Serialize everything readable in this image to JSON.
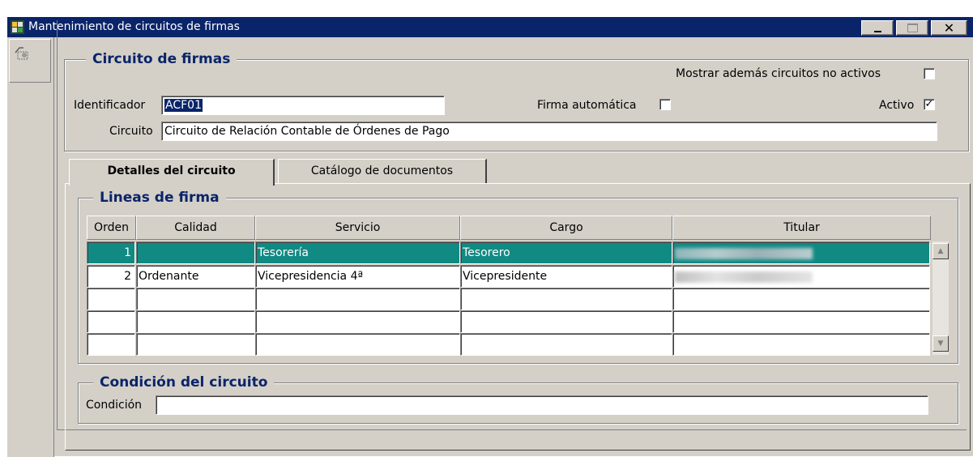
{
  "window": {
    "title": "Mantenimiento de circuitos de firmas",
    "minimize_label": "_",
    "close_label": "✕"
  },
  "circuito_section": {
    "legend": "Circuito de firmas",
    "show_inactive_label": "Mostrar además circuitos no activos",
    "show_inactive_checked": false,
    "identificador_label": "Identificador",
    "identificador_value": "ACF01",
    "firma_auto_label": "Firma automática",
    "firma_auto_checked": false,
    "activo_label": "Activo",
    "activo_checked": true,
    "activo_mark": "✓",
    "circuito_label": "Circuito",
    "circuito_value": "Circuito de  Relación Contable de Órdenes de Pago"
  },
  "tabs": [
    {
      "label": "Detalles del circuito",
      "active": true
    },
    {
      "label": "Catálogo de documentos",
      "active": false
    }
  ],
  "lineas_section": {
    "legend": "Lineas de firma",
    "columns": [
      "Orden",
      "Calidad",
      "Servicio",
      "Cargo",
      "Titular"
    ],
    "rows": [
      {
        "orden": "1",
        "calidad": "",
        "servicio": "Tesorería",
        "cargo": "Tesorero",
        "titular": "[blurred]"
      },
      {
        "orden": "2",
        "calidad": "Ordenante",
        "servicio": "Vicepresidencia 4ª",
        "cargo": "Vicepresidente",
        "titular": "[blurred]"
      }
    ],
    "scroll_up": "▲",
    "scroll_down": "▼"
  },
  "condicion_section": {
    "legend": "Condición del circuito",
    "condicion_label": "Condición",
    "condicion_value": ""
  },
  "colors": {
    "titlebar": "#0a246a",
    "selected_row": "#118a84",
    "legend_text": "#0a246a",
    "face": "#d4d0c8"
  }
}
